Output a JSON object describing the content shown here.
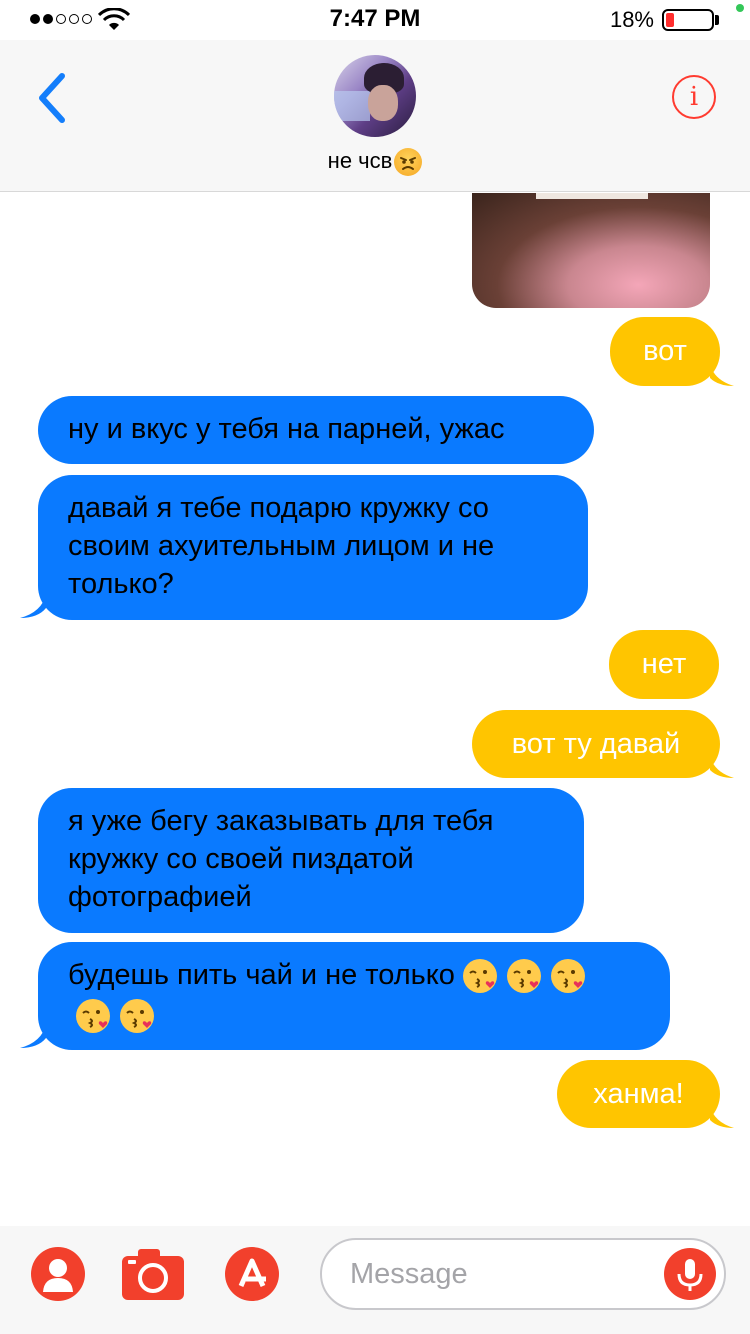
{
  "status_bar": {
    "time": "7:47 PM",
    "battery_percent": "18%",
    "battery_level": 0.18,
    "signal_bars_filled": 2,
    "signal_bars_total": 5
  },
  "header": {
    "contact_name": "не чсв",
    "contact_emoji": "angry-face-emoji",
    "back_icon": "chevron-left-icon",
    "info_icon": "info-icon"
  },
  "messages": [
    {
      "direction": "outgoing",
      "text": "вот"
    },
    {
      "direction": "incoming",
      "text": "ну и вкус у тебя на парней, ужас"
    },
    {
      "direction": "incoming",
      "lines": [
        "давай я тебе подарю кружку со",
        "своим ахуительным лицом и не",
        "только?"
      ]
    },
    {
      "direction": "outgoing",
      "text": "нет"
    },
    {
      "direction": "outgoing",
      "text": "вот ту давай"
    },
    {
      "direction": "incoming",
      "lines": [
        "я уже бегу заказывать для тебя",
        "кружку со своей пиздатой",
        "фотографией"
      ]
    },
    {
      "direction": "incoming",
      "lines": [
        "будешь пить чай и не только",
        ""
      ],
      "emoji": "kissing-heart-emoji",
      "emoji_count": 5
    },
    {
      "direction": "outgoing",
      "text": "ханма!"
    }
  ],
  "composer": {
    "placeholder": "Message",
    "value": "",
    "contacts_icon": "person-icon",
    "camera_icon": "camera-icon",
    "app_icon": "app-store-icon",
    "mic_icon": "microphone-icon"
  },
  "colors": {
    "outgoing_bubble": "#ffc500",
    "incoming_bubble": "#0a7aff",
    "accent_red": "#f2402c",
    "back_blue": "#147efb"
  }
}
